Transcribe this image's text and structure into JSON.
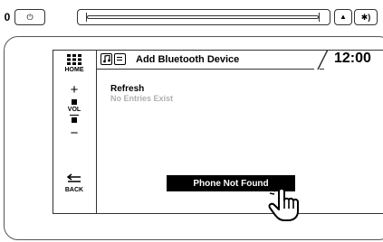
{
  "hardware": {
    "left_glyph": "0",
    "power_icon": "⏻",
    "eject_icon": "▲",
    "seek_icon": "✱)"
  },
  "rail": {
    "home_label": "HOME",
    "plus_glyph": "+",
    "vol_label": "VOL",
    "minus_glyph": "−",
    "back_label": "BACK"
  },
  "header": {
    "title": "Add Bluetooth Device",
    "clock": "12:00"
  },
  "content": {
    "refresh_label": "Refresh",
    "empty_message": "No Entries Exist"
  },
  "popup": {
    "label": "Phone Not Found"
  },
  "colors": {
    "screen_bg": "#ffffff",
    "line": "#333333",
    "muted_text": "#b0b0b0",
    "popup_bg": "#000000",
    "popup_text": "#ffffff"
  }
}
